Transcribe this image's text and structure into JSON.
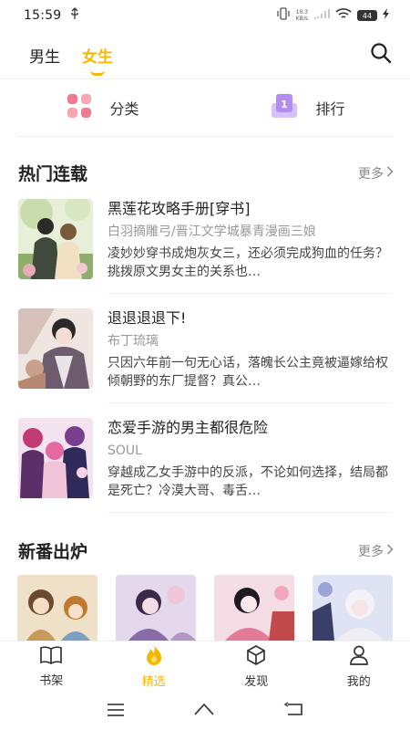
{
  "status_bar": {
    "time": "15:59",
    "network_speed_value": "10.3",
    "network_speed_unit": "KB/s",
    "battery": "44"
  },
  "top_tabs": [
    {
      "label": "男生",
      "active": false
    },
    {
      "label": "女生",
      "active": true
    }
  ],
  "quick_links": [
    {
      "label": "分类",
      "icon": "category-grid-icon"
    },
    {
      "label": "排行",
      "icon": "ranking-badge-icon"
    }
  ],
  "hot_section": {
    "title": "热门连载",
    "more": "更多",
    "books": [
      {
        "title": "黑莲花攻略手册[穿书]",
        "author": "白羽摘雕弓/晋江文学城暴青漫画三娘",
        "desc": "凌妙妙穿书成炮灰女三，还必须完成狗血的任务？挑拨原文男女主的关系也…"
      },
      {
        "title": "退退退退下!",
        "author": "布丁琉璃",
        "desc": "只因六年前一句无心话，落魄长公主竟被逼嫁给权倾朝野的东厂提督？真公…"
      },
      {
        "title": "恋爱手游的男主都很危险",
        "author": "SOUL",
        "desc": "穿越成乙女手游中的反派，不论如何选择，结局都是死亡？冷漠大哥、毒舌…"
      }
    ]
  },
  "new_section": {
    "title": "新番出炉",
    "more": "更多"
  },
  "bottom_nav": [
    {
      "label": "书架",
      "icon": "book-open-icon",
      "active": false
    },
    {
      "label": "精选",
      "icon": "flame-icon",
      "active": true
    },
    {
      "label": "发现",
      "icon": "cube-icon",
      "active": false
    },
    {
      "label": "我的",
      "icon": "user-icon",
      "active": false
    }
  ],
  "colors": {
    "accent": "#f5b800",
    "category_icon": "#f07a8f",
    "ranking_icon": "#b38cf0"
  }
}
